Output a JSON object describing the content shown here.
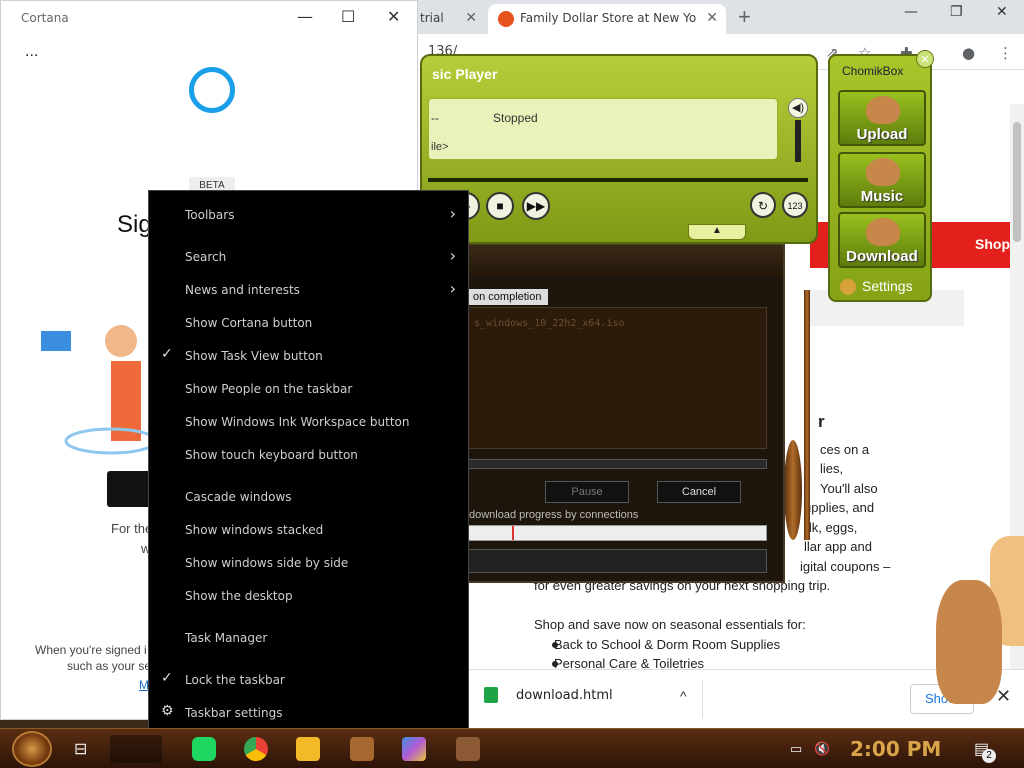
{
  "browser": {
    "tabs": [
      {
        "label": "trial",
        "close": "✕"
      },
      {
        "label": "Family Dollar Store at New Yo",
        "close": "✕"
      }
    ],
    "new_tab": "+",
    "url_fragment": "136/",
    "window_buttons": {
      "minimize": "—",
      "restore": "❐",
      "close": "✕"
    },
    "toolbar_icons": {
      "share": "⇗",
      "star": "☆",
      "extensions": "✚",
      "profile": "●",
      "menu": "⋮"
    },
    "banner_button": "Shop",
    "article": {
      "heading_fragment": "r",
      "lines": [
        "ces on a",
        "lies,",
        "You'll also",
        "upplies, and",
        "ilk, eggs,",
        "llar app and",
        "igital coupons –",
        "for even greater savings on your next shopping trip."
      ],
      "shop_line": "Shop and save now on seasonal essentials for:",
      "bullets": [
        "Back to School & Dorm Room Supplies",
        "Personal Care & Toiletries"
      ]
    },
    "download_bar": {
      "file": "download.html",
      "caret": "^",
      "show_all": "Show",
      "close": "✕"
    }
  },
  "download_dialog": {
    "tab": "on completion",
    "file": "s_windows_10_22h2_x64.iso",
    "pause": "Pause",
    "cancel": "Cancel",
    "connections": "download progress by connections"
  },
  "player": {
    "title": "sic Player",
    "dashes": "--",
    "status": "Stopped",
    "file": "ile>",
    "vol_icon": "◀)",
    "play": "▶",
    "stop": "■",
    "next": "▶▶",
    "repeat": "↻",
    "seq": "123",
    "collapse": "▲"
  },
  "chomik": {
    "title": "ChomikBox",
    "close": "✕",
    "upload": "Upload",
    "music": "Music",
    "download": "Download",
    "settings": "Settings"
  },
  "cortana": {
    "title": "Cortana",
    "minimize": "—",
    "maximize": "☐",
    "close": "✕",
    "more": "...",
    "beta": "BETA",
    "heading_fragment": "Sig",
    "for_fragment": "For the",
    "w_fragment": "w",
    "when_fragment": "When you're signed i",
    "such_fragment": "such as your se",
    "link_fragment": "M"
  },
  "context_menu": {
    "items": [
      {
        "label": "Toolbars",
        "submenu": true,
        "checked": false
      },
      {
        "label": "Search",
        "submenu": true,
        "checked": false
      },
      {
        "label": "News and interests",
        "submenu": true,
        "checked": false
      },
      {
        "label": "Show Cortana button",
        "submenu": false,
        "checked": false
      },
      {
        "label": "Show Task View button",
        "submenu": false,
        "checked": true
      },
      {
        "label": "Show People on the taskbar",
        "submenu": false,
        "checked": false
      },
      {
        "label": "Show Windows Ink Workspace button",
        "submenu": false,
        "checked": false
      },
      {
        "label": "Show touch keyboard button",
        "submenu": false,
        "checked": false
      },
      {
        "label": "Cascade windows",
        "submenu": false,
        "checked": false
      },
      {
        "label": "Show windows stacked",
        "submenu": false,
        "checked": false
      },
      {
        "label": "Show windows side by side",
        "submenu": false,
        "checked": false
      },
      {
        "label": "Show the desktop",
        "submenu": false,
        "checked": false
      },
      {
        "label": "Task Manager",
        "submenu": false,
        "checked": false
      },
      {
        "label": "Lock the taskbar",
        "submenu": false,
        "checked": true
      },
      {
        "label": "Taskbar settings",
        "submenu": false,
        "checked": false,
        "icon": "gear-icon"
      }
    ],
    "chevron": "›",
    "check": "✓",
    "gear": "⚙"
  },
  "taskbar": {
    "taskview_icon": "⊟",
    "clock": "2:00 PM",
    "net_icon": "▭",
    "vol_icon": "🔇",
    "notif_icon": "▤",
    "notif_count": "2"
  },
  "colors": {
    "accent_green": "#9ab02a",
    "chrome_bg": "#dee1e6",
    "menu_bg": "#000000",
    "taskbar_brown": "#3e1e0c"
  }
}
